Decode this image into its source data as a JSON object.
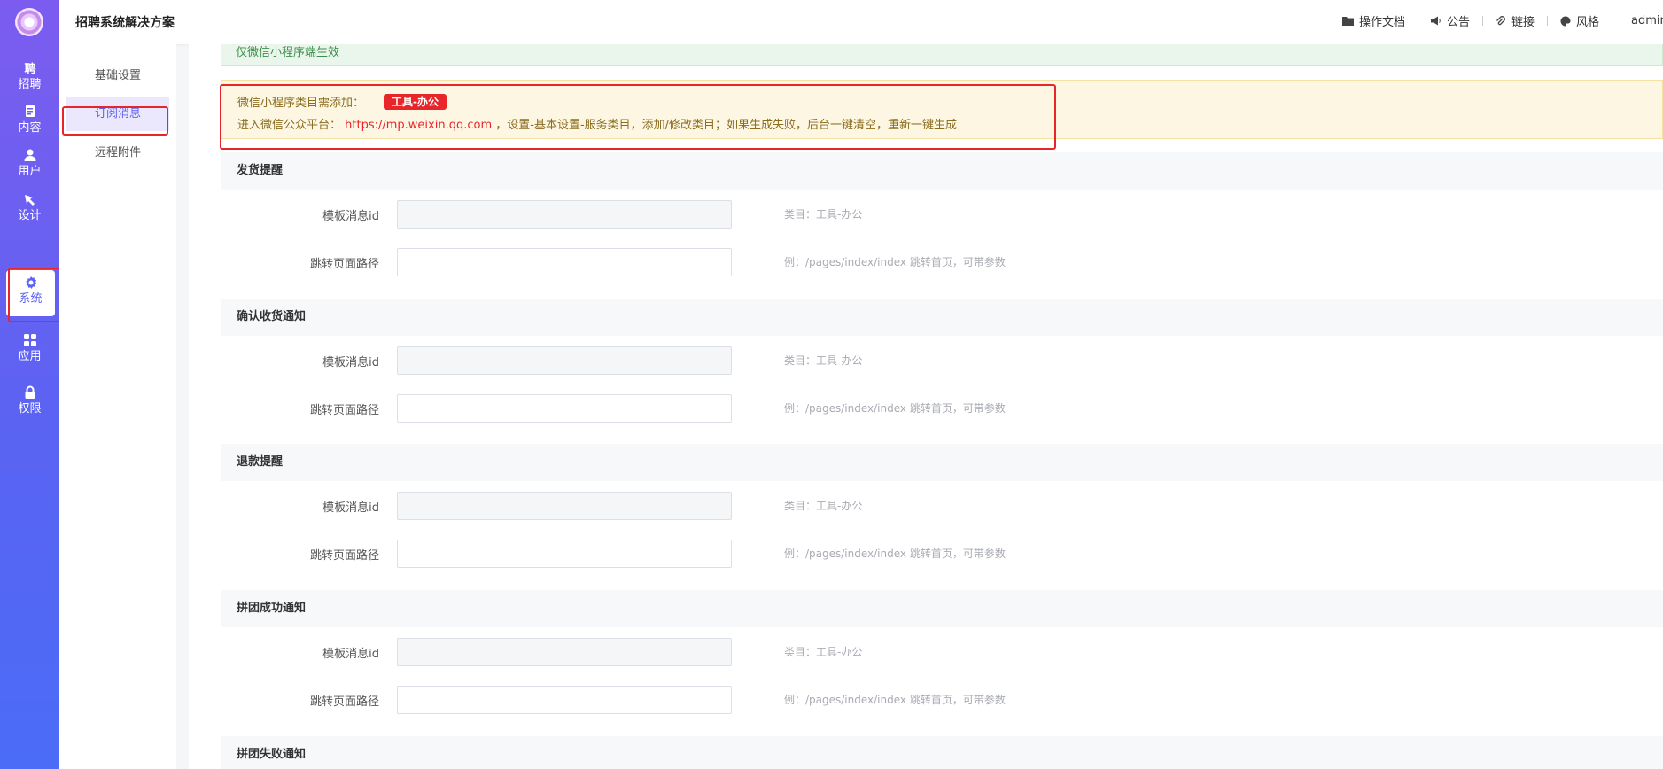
{
  "app": {
    "title": "招聘系统解决方案"
  },
  "header": {
    "links": [
      {
        "label": "操作文档",
        "icon": "folder-icon"
      },
      {
        "label": "公告",
        "icon": "megaphone-icon"
      },
      {
        "label": "链接",
        "icon": "paperclip-icon"
      },
      {
        "label": "风格",
        "icon": "palette-icon"
      }
    ],
    "user": "admin"
  },
  "rail": {
    "items": [
      {
        "label": "招聘",
        "icon": "recruit-icon"
      },
      {
        "label": "内容",
        "icon": "document-icon"
      },
      {
        "label": "用户",
        "icon": "user-icon"
      },
      {
        "label": "设计",
        "icon": "design-icon"
      },
      {
        "label": "系统",
        "icon": "gear-icon",
        "active": true
      },
      {
        "label": "应用",
        "icon": "apps-grid-icon"
      },
      {
        "label": "权限",
        "icon": "lock-icon"
      }
    ]
  },
  "subnav": {
    "items": [
      {
        "label": "基础设置"
      },
      {
        "label": "订阅消息",
        "active": true
      },
      {
        "label": "远程附件"
      }
    ]
  },
  "notice": {
    "green": "仅微信小程序端生效",
    "yellow_prefix": "微信小程序类目需添加：",
    "yellow_tag": "工具-办公",
    "line2_prefix": "进入微信公众平台：",
    "line2_link": "https://mp.weixin.qq.com",
    "line2_suffix": "，设置-基本设置-服务类目，添加/修改类目；如果生成失败，后台一键清空，重新一键生成"
  },
  "form": {
    "template_label": "模板消息id",
    "path_label": "跳转页面路径",
    "category_hint": "类目：工具-办公",
    "path_hint": "例：/pages/index/index 跳转首页，可带参数",
    "sections": [
      {
        "title": "发货提醒"
      },
      {
        "title": "确认收货通知"
      },
      {
        "title": "退款提醒"
      },
      {
        "title": "拼团成功通知"
      },
      {
        "title": "拼团失败通知"
      }
    ]
  },
  "colors": {
    "accent": "#5b63f2",
    "highlight": "#e8262a",
    "tag": "#e8262a"
  }
}
